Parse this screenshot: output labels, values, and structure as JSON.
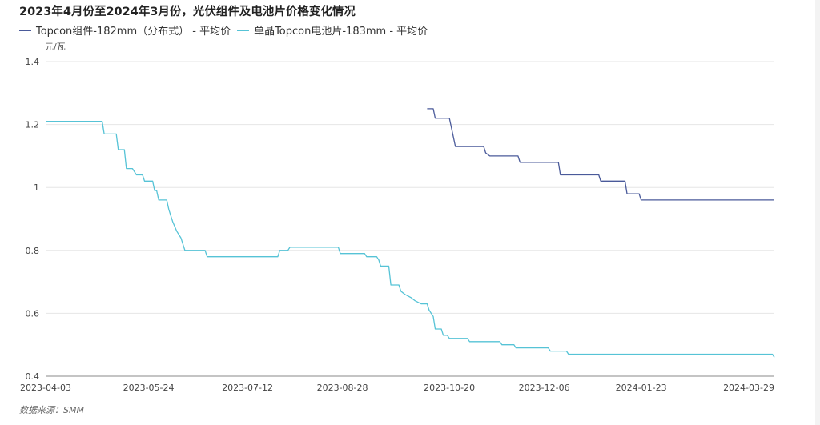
{
  "chart_data": {
    "type": "line",
    "title": "2023年4月份至2024年3月份，光伏组件及电池片价格变化情况",
    "ylabel": "元/瓦",
    "ylim": [
      0.4,
      1.4
    ],
    "yticks": [
      "0.4",
      "0.6",
      "0.8",
      "1",
      "1.2",
      "1.4"
    ],
    "yticks_values": [
      0.4,
      0.6,
      0.8,
      1.0,
      1.2,
      1.4
    ],
    "xticks": [
      {
        "label": "2023-04-03",
        "date": "2023-04-03"
      },
      {
        "label": "2023-05-24",
        "date": "2023-05-24"
      },
      {
        "label": "2023-07-12",
        "date": "2023-07-12"
      },
      {
        "label": "2023-08-28",
        "date": "2023-08-28"
      },
      {
        "label": "2023-10-20",
        "date": "2023-10-20"
      },
      {
        "label": "2023-12-06",
        "date": "2023-12-06"
      },
      {
        "label": "2024-01-23",
        "date": "2024-01-23"
      },
      {
        "label": "2024-03-29",
        "date": "2024-03-29"
      }
    ],
    "xlim": [
      "2023-04-03",
      "2024-03-29"
    ],
    "grid": true,
    "legend_position": "top-left",
    "source": "数据来源：SMM",
    "series": [
      {
        "name": "Topcon组件-182mm（分布式） - 平均价",
        "color": "#4a5a9a",
        "points": [
          [
            "2023-10-09",
            1.25
          ],
          [
            "2023-10-12",
            1.25
          ],
          [
            "2023-10-13",
            1.22
          ],
          [
            "2023-10-20",
            1.22
          ],
          [
            "2023-10-23",
            1.13
          ],
          [
            "2023-11-06",
            1.13
          ],
          [
            "2023-11-07",
            1.11
          ],
          [
            "2023-11-09",
            1.1
          ],
          [
            "2023-11-23",
            1.1
          ],
          [
            "2023-11-24",
            1.08
          ],
          [
            "2023-12-13",
            1.08
          ],
          [
            "2023-12-14",
            1.04
          ],
          [
            "2024-01-02",
            1.04
          ],
          [
            "2024-01-03",
            1.02
          ],
          [
            "2024-01-15",
            1.02
          ],
          [
            "2024-01-16",
            0.98
          ],
          [
            "2024-01-22",
            0.98
          ],
          [
            "2024-01-23",
            0.96
          ],
          [
            "2024-03-29",
            0.96
          ]
        ]
      },
      {
        "name": "单晶Topcon电池片-183mm - 平均价",
        "color": "#56c3d6",
        "points": [
          [
            "2023-04-03",
            1.21
          ],
          [
            "2023-05-01",
            1.21
          ],
          [
            "2023-05-02",
            1.17
          ],
          [
            "2023-05-08",
            1.17
          ],
          [
            "2023-05-09",
            1.12
          ],
          [
            "2023-05-12",
            1.12
          ],
          [
            "2023-05-13",
            1.06
          ],
          [
            "2023-05-16",
            1.06
          ],
          [
            "2023-05-18",
            1.04
          ],
          [
            "2023-05-21",
            1.04
          ],
          [
            "2023-05-22",
            1.02
          ],
          [
            "2023-05-26",
            1.02
          ],
          [
            "2023-05-27",
            0.99
          ],
          [
            "2023-05-28",
            0.99
          ],
          [
            "2023-05-29",
            0.96
          ],
          [
            "2023-06-02",
            0.96
          ],
          [
            "2023-06-03",
            0.93
          ],
          [
            "2023-06-05",
            0.89
          ],
          [
            "2023-06-07",
            0.86
          ],
          [
            "2023-06-09",
            0.84
          ],
          [
            "2023-06-11",
            0.8
          ],
          [
            "2023-06-21",
            0.8
          ],
          [
            "2023-06-22",
            0.78
          ],
          [
            "2023-07-27",
            0.78
          ],
          [
            "2023-07-28",
            0.8
          ],
          [
            "2023-08-01",
            0.8
          ],
          [
            "2023-08-02",
            0.81
          ],
          [
            "2023-08-26",
            0.81
          ],
          [
            "2023-08-27",
            0.79
          ],
          [
            "2023-09-08",
            0.79
          ],
          [
            "2023-09-09",
            0.78
          ],
          [
            "2023-09-14",
            0.78
          ],
          [
            "2023-09-15",
            0.77
          ],
          [
            "2023-09-16",
            0.75
          ],
          [
            "2023-09-20",
            0.75
          ],
          [
            "2023-09-21",
            0.69
          ],
          [
            "2023-09-25",
            0.69
          ],
          [
            "2023-09-26",
            0.67
          ],
          [
            "2023-09-28",
            0.66
          ],
          [
            "2023-10-01",
            0.65
          ],
          [
            "2023-10-03",
            0.64
          ],
          [
            "2023-10-06",
            0.63
          ],
          [
            "2023-10-09",
            0.63
          ],
          [
            "2023-10-10",
            0.61
          ],
          [
            "2023-10-12",
            0.59
          ],
          [
            "2023-10-13",
            0.55
          ],
          [
            "2023-10-16",
            0.55
          ],
          [
            "2023-10-17",
            0.53
          ],
          [
            "2023-10-19",
            0.53
          ],
          [
            "2023-10-20",
            0.52
          ],
          [
            "2023-10-29",
            0.52
          ],
          [
            "2023-10-30",
            0.51
          ],
          [
            "2023-11-14",
            0.51
          ],
          [
            "2023-11-15",
            0.5
          ],
          [
            "2023-11-21",
            0.5
          ],
          [
            "2023-11-22",
            0.49
          ],
          [
            "2023-12-08",
            0.49
          ],
          [
            "2023-12-09",
            0.48
          ],
          [
            "2023-12-17",
            0.48
          ],
          [
            "2023-12-18",
            0.47
          ],
          [
            "2024-03-28",
            0.47
          ],
          [
            "2024-03-29",
            0.46
          ]
        ]
      }
    ]
  }
}
